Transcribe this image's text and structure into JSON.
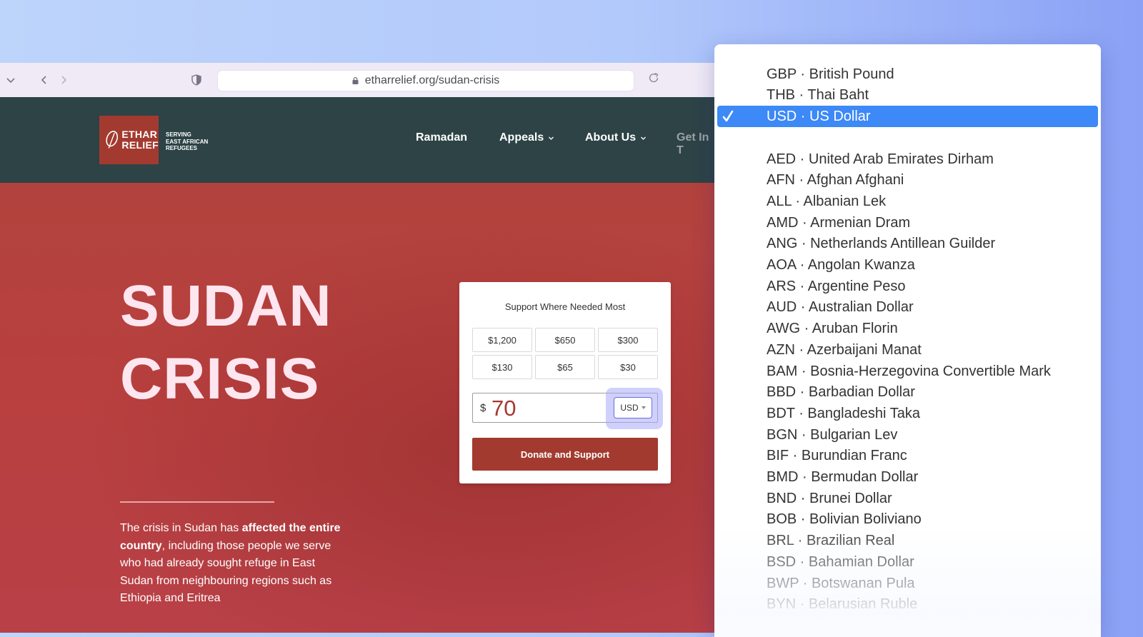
{
  "browser": {
    "url": "etharrelief.org/sudan-crisis"
  },
  "header": {
    "logo_text_line1": "ETHAR",
    "logo_text_line2": "RELIEF",
    "tagline_line1": "SERVING",
    "tagline_line2": "EAST AFRICAN",
    "tagline_line3": "REFUGEES",
    "nav": {
      "ramadan": "Ramadan",
      "appeals": "Appeals",
      "about": "About Us",
      "get_in": "Get In T"
    }
  },
  "hero": {
    "title_line1": "SUDAN",
    "title_line2": "CRISIS",
    "desc_part1": "The crisis in Sudan has ",
    "desc_bold": "affected the entire country",
    "desc_part2": ", including those people we serve who had already sought refuge in East Sudan from neighbouring regions such as Ethiopia and Eritrea"
  },
  "donate": {
    "title": "Support Where Needed Most",
    "amounts": [
      "$1,200",
      "$650",
      "$300",
      "$130",
      "$65",
      "$30"
    ],
    "currency_symbol": "$",
    "amount_value": "70",
    "currency_code": "USD",
    "button_label": "Donate and Support"
  },
  "dropdown": {
    "selected": "USD · US Dollar",
    "top_items": [
      "GBP · British Pound",
      "THB · Thai Baht"
    ],
    "items": [
      "AED · United Arab Emirates Dirham",
      "AFN · Afghan Afghani",
      "ALL · Albanian Lek",
      "AMD · Armenian Dram",
      "ANG · Netherlands Antillean Guilder",
      "AOA · Angolan Kwanza",
      "ARS · Argentine Peso",
      "AUD · Australian Dollar",
      "AWG · Aruban Florin",
      "AZN · Azerbaijani Manat",
      "BAM · Bosnia-Herzegovina Convertible Mark",
      "BBD · Barbadian Dollar",
      "BDT · Bangladeshi Taka",
      "BGN · Bulgarian Lev",
      "BIF · Burundian Franc",
      "BMD · Bermudan Dollar",
      "BND · Brunei Dollar",
      "BOB · Bolivian Boliviano",
      "BRL · Brazilian Real",
      "BSD · Bahamian Dollar",
      "BWP · Botswanan Pula",
      "BYN · Belarusian Ruble"
    ]
  },
  "icons": {
    "sidebar_toggle": "chevron-down-icon",
    "back": "chevron-left-icon",
    "forward": "chevron-right-icon",
    "shield": "shield-icon",
    "lock": "lock-icon",
    "reload": "reload-icon",
    "check": "checkmark-icon",
    "logo_leaf": "leaf-icon"
  },
  "colors": {
    "accent_red": "#a33a2f",
    "header_bg": "#2d4346",
    "selection_blue": "#3c89f7"
  }
}
